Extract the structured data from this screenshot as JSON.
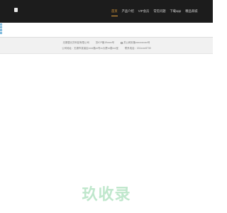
{
  "header": {
    "nav": [
      {
        "label": "首页"
      },
      {
        "label": "产品介绍"
      },
      {
        "label": "VIP会员"
      },
      {
        "label": "常见问题"
      },
      {
        "label": "下载app"
      },
      {
        "label": "精品商城"
      }
    ]
  },
  "footer": {
    "row1": {
      "company": "无锡壹元贷科技有限公司",
      "icp": "苏ICP备19xxxx号",
      "police": "苏公网安备xxxxxxxxxx号"
    },
    "row2": {
      "address": "公司地址：无锡市梁溪区xxxx路xx号xx大厦xx楼xxx室",
      "phone": "联系电话：151xxxx5730"
    }
  },
  "watermark": {
    "text": "玖收录"
  },
  "colors": {
    "header_bg": "#1c1c1c",
    "active_nav": "#e9a43b",
    "footer_bg": "#f1f1f1",
    "watermark": "#bfe7cc"
  }
}
